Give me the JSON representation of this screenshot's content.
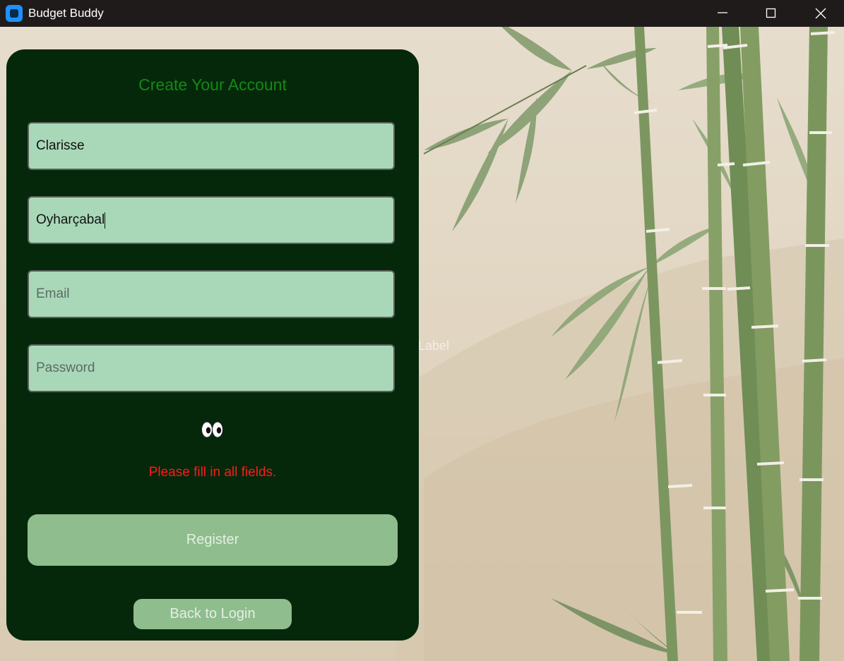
{
  "window": {
    "title": "Budget Buddy",
    "icons": {
      "app": "app-icon",
      "minimize": "minimize-icon",
      "maximize": "maximize-icon",
      "close": "close-icon"
    }
  },
  "background": {
    "stray_label": "Label"
  },
  "form": {
    "title": "Create Your Account",
    "first_name": {
      "value": "Clarisse",
      "placeholder": ""
    },
    "last_name": {
      "value": "Oyharçabal",
      "placeholder": ""
    },
    "email": {
      "value": "",
      "placeholder": "Email"
    },
    "password": {
      "value": "",
      "placeholder": "Password"
    },
    "show_password_icon": "eyes-icon",
    "error": "Please fill in all fields.",
    "register_label": "Register",
    "back_label": "Back to Login"
  },
  "colors": {
    "panel_bg": "#05280b",
    "title_green": "#138a13",
    "field_bg": "#a9d8b9",
    "button_bg": "#8fbd8e",
    "error_red": "#ff1a1a"
  }
}
